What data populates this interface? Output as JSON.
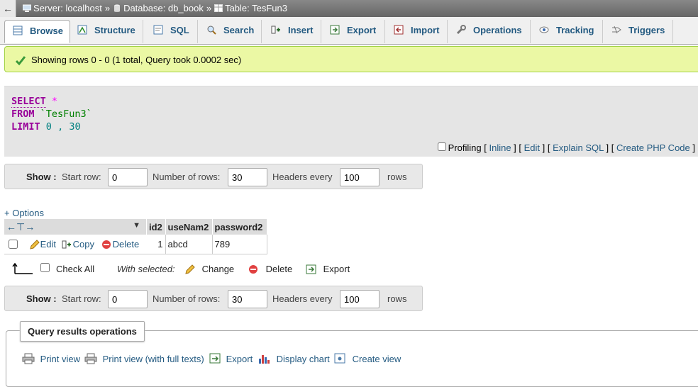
{
  "breadcrumb": {
    "back": "←",
    "server": "Server: localhost",
    "database": "Database: db_book",
    "table": "Table: TesFun3",
    "separator": "»"
  },
  "tabs": [
    {
      "label": "Browse",
      "icon": "browse-icon",
      "active": true
    },
    {
      "label": "Structure",
      "icon": "structure-icon"
    },
    {
      "label": "SQL",
      "icon": "sql-icon"
    },
    {
      "label": "Search",
      "icon": "search-icon"
    },
    {
      "label": "Insert",
      "icon": "insert-icon"
    },
    {
      "label": "Export",
      "icon": "export-icon"
    },
    {
      "label": "Import",
      "icon": "import-icon"
    },
    {
      "label": "Operations",
      "icon": "operations-icon"
    },
    {
      "label": "Tracking",
      "icon": "tracking-icon"
    },
    {
      "label": "Triggers",
      "icon": "triggers-icon"
    }
  ],
  "success_message": "Showing rows 0 - 0 (1 total, Query took 0.0002 sec)",
  "sql": {
    "select": "SELECT",
    "star": "*",
    "from": "FROM",
    "table": "`TesFun3`",
    "limit": "LIMIT",
    "offset": "0",
    "comma": ",",
    "count": "30"
  },
  "sql_links": {
    "profiling": "Profiling",
    "inline": "Inline",
    "edit": "Edit",
    "explain": "Explain SQL",
    "php": "Create PHP Code"
  },
  "nav": {
    "show": "Show :",
    "start_row_label": "Start row:",
    "start_row": "0",
    "num_rows_label": "Number of rows:",
    "num_rows": "30",
    "headers_label": "Headers every",
    "headers": "100",
    "rows_label": "rows"
  },
  "options_link": "+ Options",
  "results": {
    "columns": [
      "id2",
      "useNam2",
      "password2"
    ],
    "rows": [
      {
        "id2": "1",
        "useNam2": "abcd",
        "password2": "789"
      }
    ],
    "row_actions": {
      "edit": "Edit",
      "copy": "Copy",
      "delete": "Delete"
    }
  },
  "bulk": {
    "check_all": "Check All",
    "with_selected": "With selected:",
    "change": "Change",
    "delete": "Delete",
    "export": "Export"
  },
  "operations": {
    "legend": "Query results operations",
    "print_view": "Print view",
    "print_full": "Print view (with full texts)",
    "export": "Export",
    "display_chart": "Display chart",
    "create_view": "Create view"
  },
  "colors": {
    "link": "#235a81",
    "success_bg": "#ebf8a4",
    "keyword": "#990099"
  }
}
